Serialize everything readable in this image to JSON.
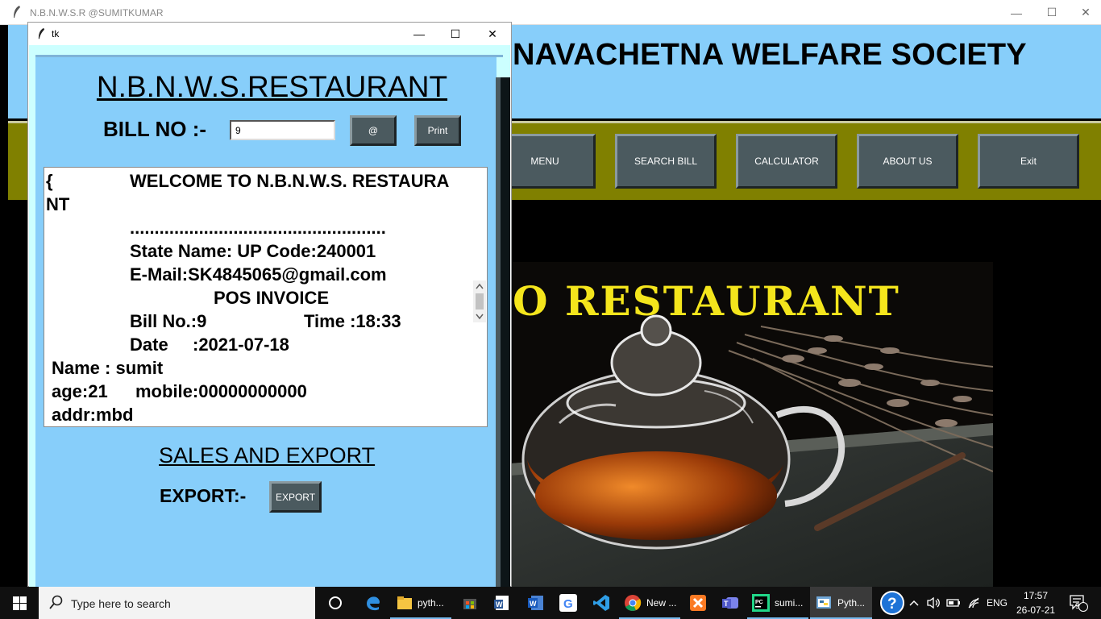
{
  "main_window": {
    "title": "N.B.N.W.S.R @SUMITKUMAR",
    "society_title": "NAVACHETNA WELFARE SOCIETY",
    "banner_text": "O RESTAURANT",
    "nav_buttons": [
      {
        "label": "MENU"
      },
      {
        "label": "SEARCH BILL"
      },
      {
        "label": "CALCULATOR"
      },
      {
        "label": "ABOUT US"
      },
      {
        "label": "Exit"
      }
    ]
  },
  "dialog": {
    "title": "tk",
    "heading": "N.B.N.W.S.RESTAURANT",
    "bill_label": "BILL NO :-",
    "bill_value": "9",
    "at_button": "@",
    "print_button": "Print",
    "receipt": {
      "brace": "{",
      "welcome": "WELCOME TO N.B.N.W.S. RESTAURA",
      "welcome_wrap": "NT",
      "dots": "....................................................",
      "state": "State Name: UP Code:240001",
      "email": "E-Mail:SK4845065@gmail.com",
      "pos": "POS INVOICE",
      "bill_no": "Bill No.:9",
      "time": "Time :18:33",
      "date_label": "Date",
      "date_value": ":2021-07-18",
      "name": "Name : sumit",
      "age": "age:21",
      "mobile": "mobile:00000000000",
      "addr": "addr:mbd"
    },
    "sales_heading": "SALES AND EXPORT",
    "export_label": "EXPORT:-",
    "export_button": "EXPORT"
  },
  "taskbar": {
    "search_placeholder": "Type here to search",
    "apps": [
      {
        "label": "pyth...",
        "icon": "folder-icon"
      },
      {
        "label": "New ...",
        "icon": "chrome-icon"
      },
      {
        "label": "sumi...",
        "icon": "pycharm-icon"
      },
      {
        "label": "Pyth...",
        "icon": "python-icon"
      }
    ],
    "language": "ENG",
    "time": "17:57",
    "date": "26-07-21",
    "notification_count": "9",
    "colors": {
      "accent": "#76b9ed",
      "taskbar": "#101010"
    }
  }
}
